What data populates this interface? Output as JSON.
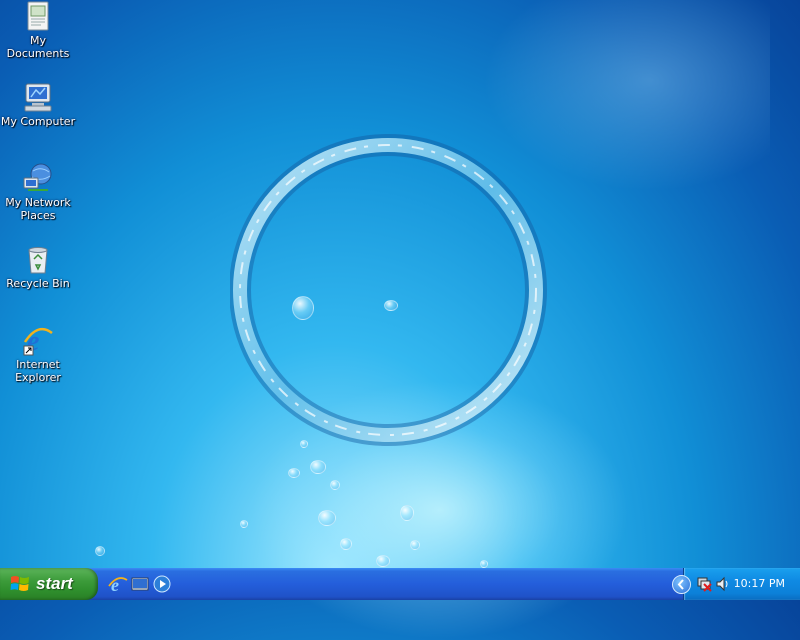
{
  "desktop": {
    "icons": [
      {
        "label": "My Documents",
        "icon": "my-documents-icon"
      },
      {
        "label": "My Computer",
        "icon": "my-computer-icon"
      },
      {
        "label": "My Network Places",
        "icon": "network-places-icon"
      },
      {
        "label": "Recycle Bin",
        "icon": "recycle-bin-icon"
      },
      {
        "label": "Internet Explorer",
        "icon": "internet-explorer-icon"
      }
    ]
  },
  "taskbar": {
    "start_label": "start",
    "quick_launch": [
      "internet-explorer-icon",
      "show-desktop-icon",
      "media-player-icon"
    ],
    "tray": {
      "icons": [
        "expand-tray-icon",
        "network-disconnected-icon",
        "volume-icon"
      ],
      "clock": "10:17 PM"
    }
  },
  "colors": {
    "taskbar_blue": "#245edb",
    "start_green": "#3c9b3a",
    "tray_blue": "#0f8ae3"
  }
}
